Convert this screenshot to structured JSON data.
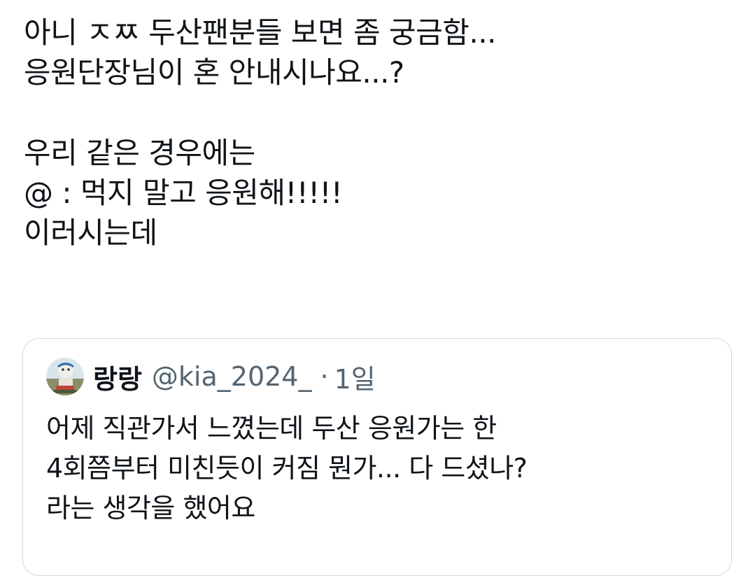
{
  "tweet": {
    "lines": [
      "아니 ㅈㅉ 두산팬분들 보면 좀 궁금함...",
      "응원단장님이 혼 안내시나요...?",
      "",
      "우리 같은 경우에는",
      "@ : 먹지 말고 응원해!!!!!",
      "이러시는데"
    ]
  },
  "quoted_tweet": {
    "avatar_icon": "avatar-icon",
    "display_name": "랑랑",
    "handle": "@kia_2024_",
    "separator": "·",
    "timestamp": "1일",
    "lines": [
      "어제 직관가서 느꼈는데 두산 응원가는 한",
      "4회쯤부터 미친듯이 커짐 뭔가... 다 드셨나?",
      "라는 생각을 했어요"
    ]
  },
  "colors": {
    "text_primary": "#0f1419",
    "text_secondary": "#536471",
    "border": "#cfd9de",
    "background": "#ffffff"
  }
}
